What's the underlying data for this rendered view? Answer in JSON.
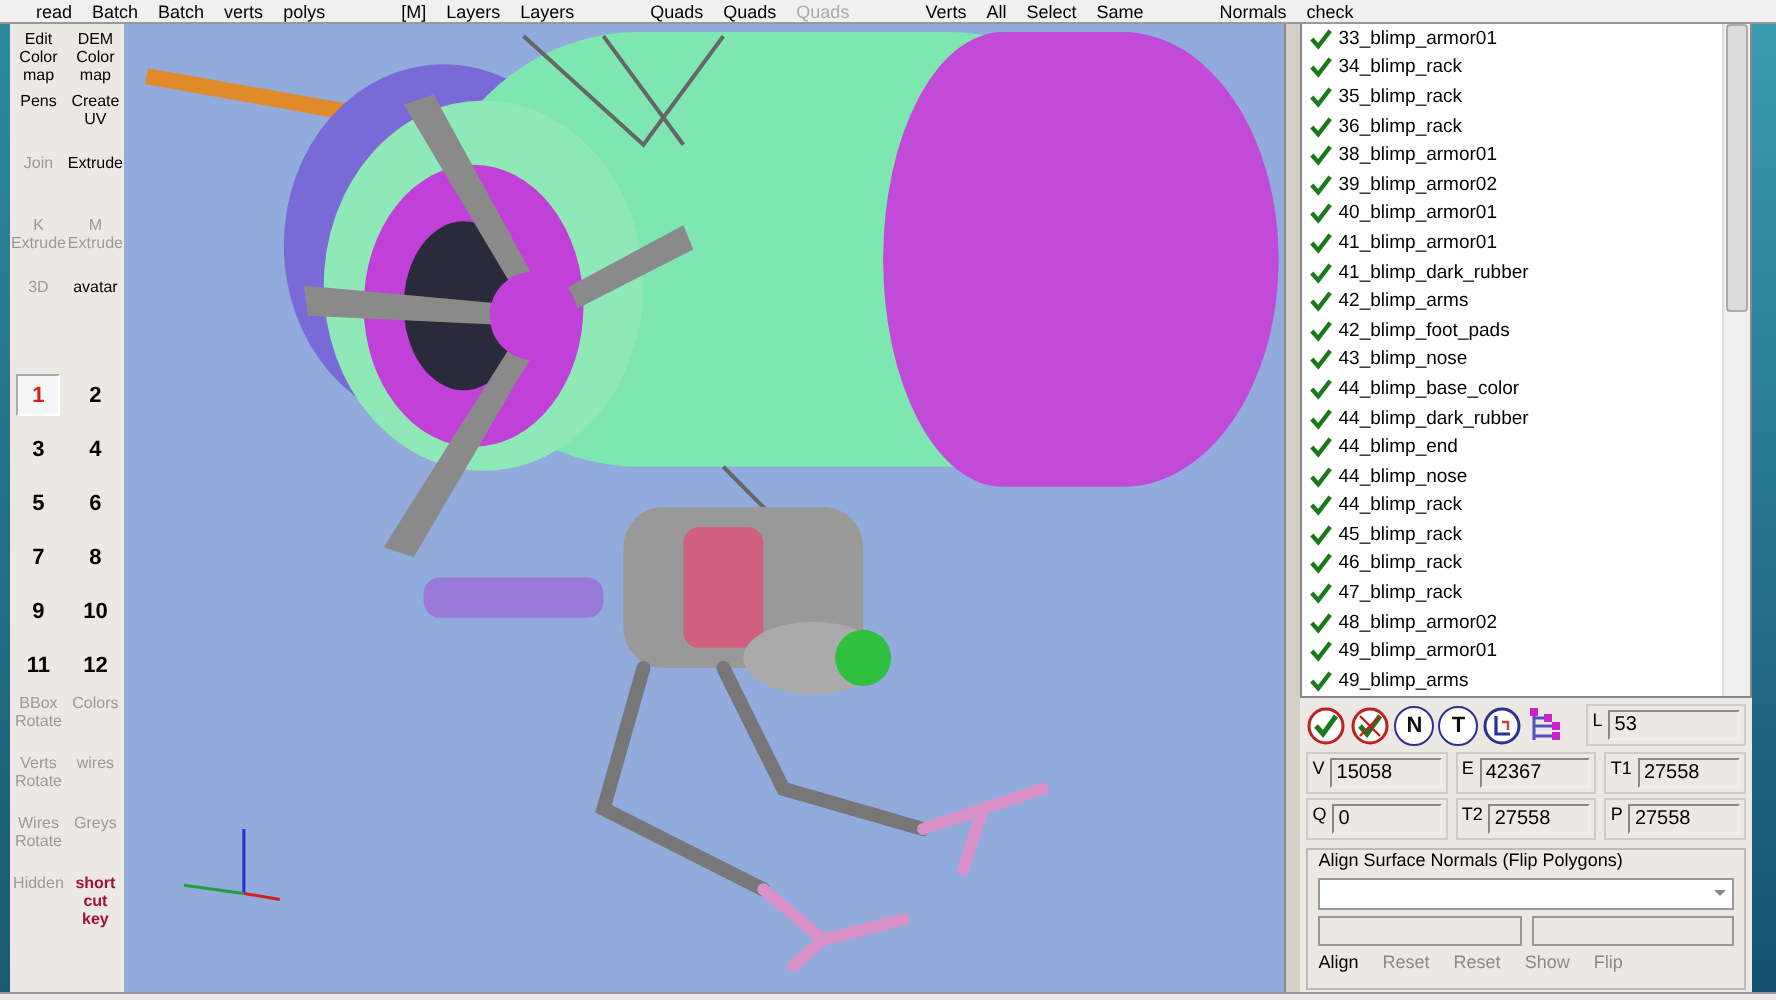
{
  "top_toolbar": [
    {
      "items": [
        {
          "label": "read",
          "disabled": false
        },
        {
          "label": "Batch",
          "disabled": false
        },
        {
          "label": "Batch",
          "disabled": false
        },
        {
          "label": "verts",
          "disabled": false
        },
        {
          "label": "polys",
          "disabled": false
        }
      ]
    },
    {
      "items": [
        {
          "label": "[M]",
          "disabled": false
        },
        {
          "label": "Layers",
          "disabled": false
        },
        {
          "label": "Layers",
          "disabled": false
        }
      ]
    },
    {
      "items": [
        {
          "label": "Quads",
          "disabled": false
        },
        {
          "label": "Quads",
          "disabled": false
        },
        {
          "label": "Quads",
          "disabled": true
        }
      ]
    },
    {
      "items": [
        {
          "label": "Verts",
          "disabled": false
        },
        {
          "label": "All",
          "disabled": false
        },
        {
          "label": "Select",
          "disabled": false
        },
        {
          "label": "Same",
          "disabled": false
        }
      ]
    },
    {
      "items": [
        {
          "label": "Normals",
          "disabled": false
        },
        {
          "label": "check",
          "disabled": false
        }
      ]
    }
  ],
  "tools": [
    {
      "lines": [
        "Edit",
        "Color",
        "map"
      ],
      "disabled": false
    },
    {
      "lines": [
        "DEM",
        "Color",
        "map"
      ],
      "disabled": false
    },
    {
      "lines": [
        "Pens"
      ],
      "disabled": false
    },
    {
      "lines": [
        "Create",
        "UV"
      ],
      "disabled": false
    },
    {
      "lines": [
        "Join"
      ],
      "disabled": true
    },
    {
      "lines": [
        "Extrude"
      ],
      "disabled": false
    },
    {
      "lines": [
        "K",
        "Extrude"
      ],
      "disabled": true
    },
    {
      "lines": [
        "M",
        "Extrude"
      ],
      "disabled": true
    },
    {
      "lines": [
        "3D"
      ],
      "disabled": true
    },
    {
      "lines": [
        "avatar"
      ],
      "disabled": false
    }
  ],
  "layers": [
    {
      "label": "1",
      "selected": true
    },
    {
      "label": "2",
      "selected": false
    },
    {
      "label": "3",
      "selected": false
    },
    {
      "label": "4",
      "selected": false
    },
    {
      "label": "5",
      "selected": false
    },
    {
      "label": "6",
      "selected": false
    },
    {
      "label": "7",
      "selected": false
    },
    {
      "label": "8",
      "selected": false
    },
    {
      "label": "9",
      "selected": false
    },
    {
      "label": "10",
      "selected": false
    },
    {
      "label": "11",
      "selected": false
    },
    {
      "label": "12",
      "selected": false
    }
  ],
  "view_tools": [
    {
      "lines": [
        "BBox",
        "Rotate"
      ],
      "disabled": true
    },
    {
      "lines": [
        "Colors"
      ],
      "disabled": true
    },
    {
      "lines": [
        "Verts",
        "Rotate"
      ],
      "disabled": true
    },
    {
      "lines": [
        "wires"
      ],
      "disabled": true
    },
    {
      "lines": [
        "Wires",
        "Rotate"
      ],
      "disabled": true
    },
    {
      "lines": [
        "Greys"
      ],
      "disabled": true
    },
    {
      "lines": [
        "Hidden"
      ],
      "disabled": true
    },
    {
      "lines": [
        "short",
        "cut",
        "key"
      ],
      "disabled": false
    }
  ],
  "objects": [
    {
      "name": "33_blimp_armor01",
      "checked": true
    },
    {
      "name": "34_blimp_rack",
      "checked": true
    },
    {
      "name": "35_blimp_rack",
      "checked": true
    },
    {
      "name": "36_blimp_rack",
      "checked": true
    },
    {
      "name": "38_blimp_armor01",
      "checked": true
    },
    {
      "name": "39_blimp_armor02",
      "checked": true
    },
    {
      "name": "40_blimp_armor01",
      "checked": true
    },
    {
      "name": "41_blimp_armor01",
      "checked": true
    },
    {
      "name": "41_blimp_dark_rubber",
      "checked": true
    },
    {
      "name": "42_blimp_arms",
      "checked": true
    },
    {
      "name": "42_blimp_foot_pads",
      "checked": true
    },
    {
      "name": "43_blimp_nose",
      "checked": true
    },
    {
      "name": "44_blimp_base_color",
      "checked": true
    },
    {
      "name": "44_blimp_dark_rubber",
      "checked": true
    },
    {
      "name": "44_blimp_end",
      "checked": true
    },
    {
      "name": "44_blimp_nose",
      "checked": true
    },
    {
      "name": "44_blimp_rack",
      "checked": true
    },
    {
      "name": "45_blimp_rack",
      "checked": true
    },
    {
      "name": "46_blimp_rack",
      "checked": true
    },
    {
      "name": "47_blimp_rack",
      "checked": true
    },
    {
      "name": "48_blimp_armor02",
      "checked": true
    },
    {
      "name": "49_blimp_armor01",
      "checked": true
    },
    {
      "name": "49_blimp_arms",
      "checked": true
    }
  ],
  "list_actions": [
    {
      "kind": "check-all"
    },
    {
      "kind": "uncheck-all"
    },
    {
      "kind": "letter",
      "label": "N"
    },
    {
      "kind": "letter",
      "label": "T"
    },
    {
      "kind": "l-box"
    },
    {
      "kind": "tree"
    }
  ],
  "count_l": {
    "label": "L",
    "value": "53"
  },
  "counts": [
    [
      {
        "label": "V",
        "value": "15058"
      },
      {
        "label": "E",
        "value": "42367"
      },
      {
        "label": "T1",
        "value": "27558"
      }
    ],
    [
      {
        "label": "Q",
        "value": "0"
      },
      {
        "label": "T2",
        "value": "27558"
      },
      {
        "label": "P",
        "value": "27558"
      }
    ]
  ],
  "align_group": {
    "title": "Align Surface Normals (Flip Polygons)",
    "buttons": [
      {
        "label": "Align",
        "disabled": false
      },
      {
        "label": "Reset",
        "disabled": true
      },
      {
        "label": "Reset",
        "disabled": true
      },
      {
        "label": "Show",
        "disabled": true
      },
      {
        "label": "Flip",
        "disabled": true
      }
    ]
  }
}
